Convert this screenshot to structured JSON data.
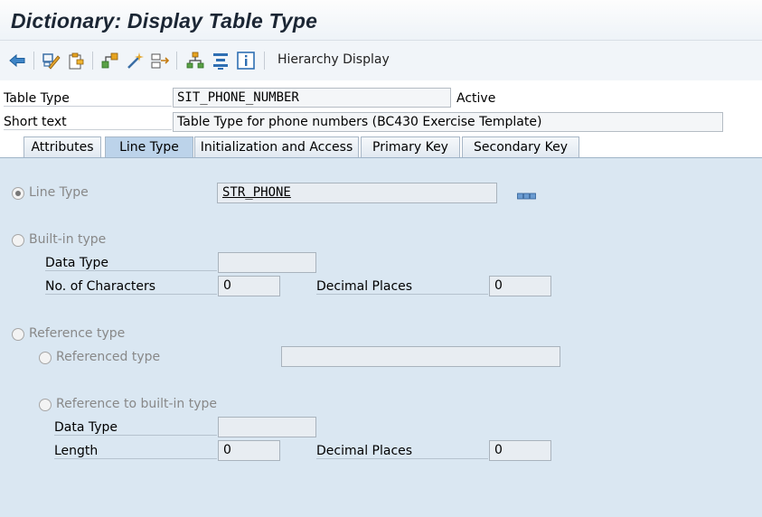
{
  "window": {
    "title": "Dictionary: Display Table Type"
  },
  "toolbar": {
    "hierarchy_display": "Hierarchy Display",
    "icons": [
      "back-icon",
      "display-change-icon",
      "where-used-icon",
      "object-list-icon",
      "activate-wand-icon",
      "transfer-icon",
      "hierarchy-tree-icon",
      "align-icon",
      "info-icon"
    ]
  },
  "header": {
    "table_type_label": "Table Type",
    "table_type_value": "SIT_PHONE_NUMBER",
    "status": "Active",
    "short_text_label": "Short text",
    "short_text_value": "Table Type for phone numbers (BC430 Exercise Template)"
  },
  "tabs": [
    {
      "label": "Attributes",
      "active": false
    },
    {
      "label": "Line Type",
      "active": true
    },
    {
      "label": "Initialization and Access",
      "active": false
    },
    {
      "label": "Primary Key",
      "active": false
    },
    {
      "label": "Secondary Key",
      "active": false
    }
  ],
  "line_type": {
    "radio_line_type": {
      "label": "Line Type",
      "selected": true
    },
    "line_type_value": "STR_PHONE",
    "radio_builtin": {
      "label": "Built-in type",
      "selected": false
    },
    "builtin_data_type_label": "Data Type",
    "builtin_data_type_value": "",
    "builtin_chars_label": "No. of Characters",
    "builtin_chars_value": "0",
    "builtin_decimals_label": "Decimal Places",
    "builtin_decimals_value": "0",
    "radio_reference": {
      "label": "Reference type",
      "selected": false
    },
    "radio_referenced_type": {
      "label": "Referenced type",
      "selected": false
    },
    "referenced_type_value": "",
    "radio_ref_builtin": {
      "label": "Reference to built-in type",
      "selected": false
    },
    "ref_data_type_label": "Data Type",
    "ref_data_type_value": "",
    "ref_length_label": "Length",
    "ref_length_value": "0",
    "ref_decimals_label": "Decimal Places",
    "ref_decimals_value": "0"
  }
}
